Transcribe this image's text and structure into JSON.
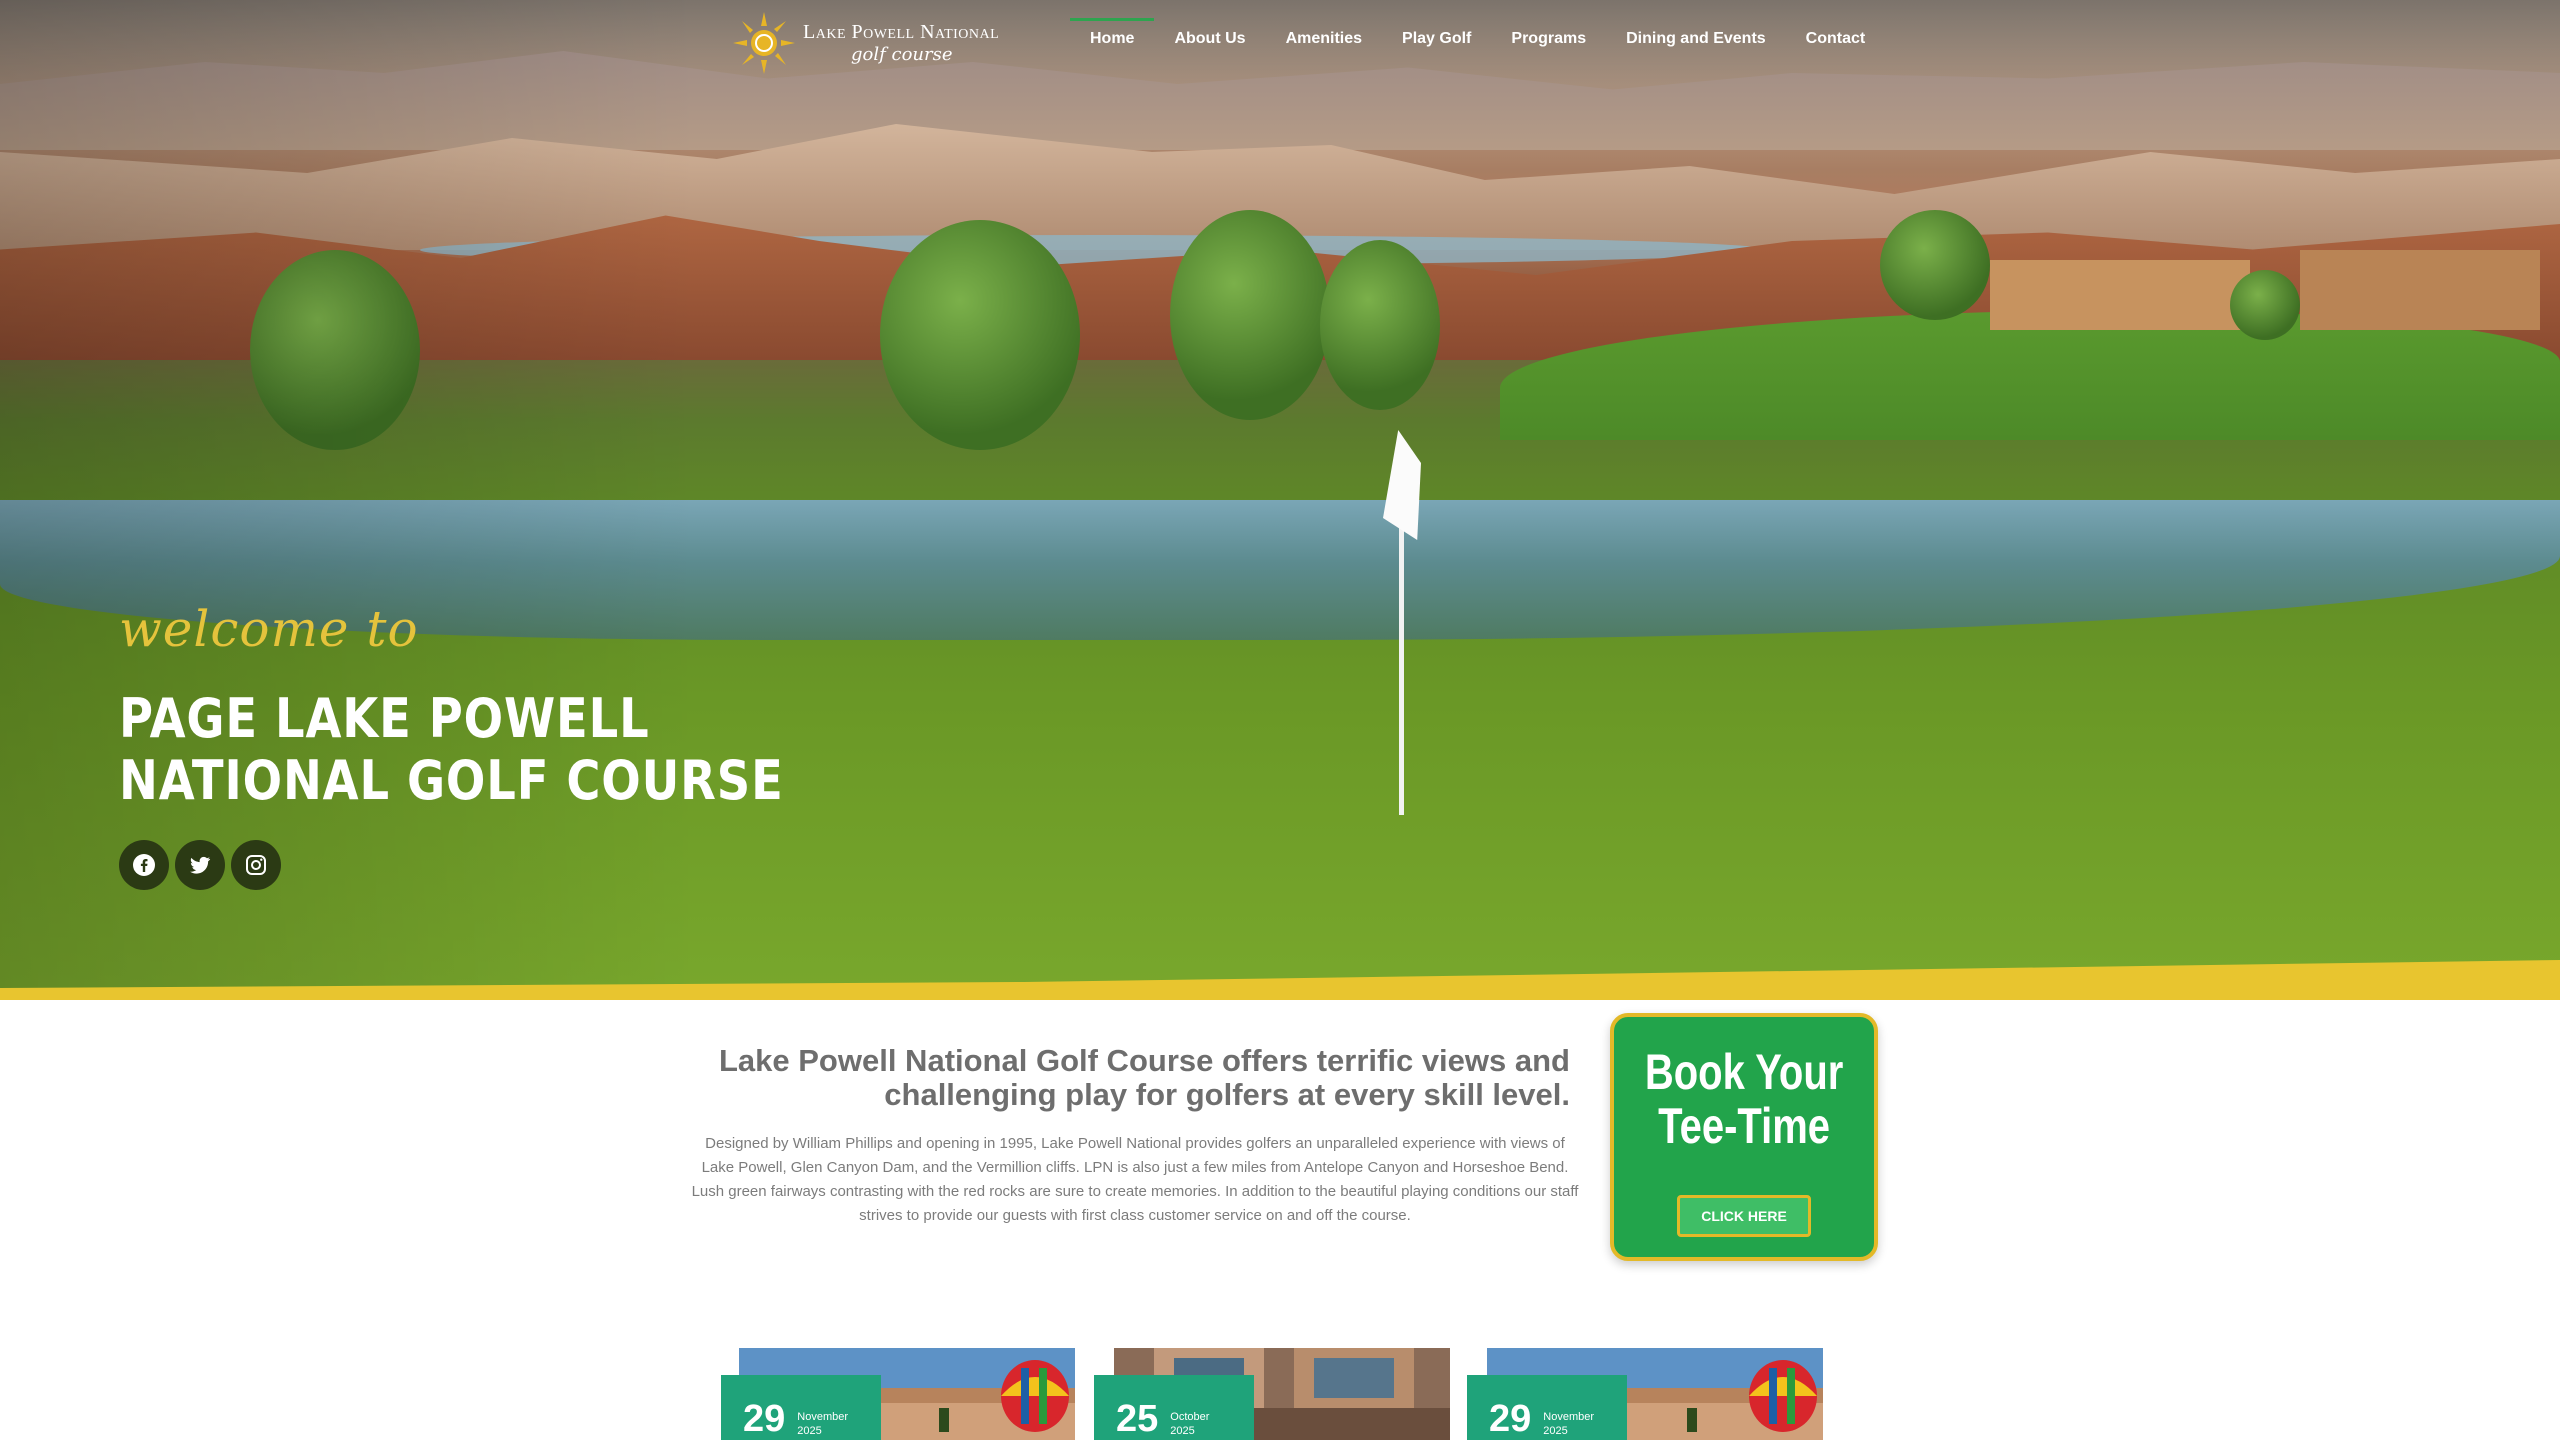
{
  "logo": {
    "title": "Lake Powell National",
    "subtitle": "golf course"
  },
  "nav": {
    "items": [
      {
        "label": "Home",
        "active": true
      },
      {
        "label": "About Us"
      },
      {
        "label": "Amenities"
      },
      {
        "label": "Play Golf"
      },
      {
        "label": "Programs"
      },
      {
        "label": "Dining and Events"
      },
      {
        "label": "Contact"
      }
    ]
  },
  "hero": {
    "welcome": "welcome to",
    "title_line1": "PAGE LAKE POWELL",
    "title_line2": "NATIONAL GOLF COURSE",
    "social": [
      "facebook-icon",
      "twitter-icon",
      "instagram-icon"
    ]
  },
  "intro": {
    "heading": "Lake Powell National Golf Course offers terrific views and challenging play for golfers at every skill level.",
    "body": "Designed by William Phillips and opening in 1995, Lake Powell National provides golfers an unparalleled experience with views of Lake Powell, Glen Canyon Dam, and the Vermillion cliffs. LPN is also just a few miles from Antelope Canyon and Horseshoe Bend. Lush green fairways contrasting with the red rocks are sure to create memories. In addition to the beautiful playing conditions our staff strives to provide our guests with first class customer service on and off the course."
  },
  "booking": {
    "title_line1": "Book Your",
    "title_line2": "Tee-Time",
    "button": "CLICK HERE"
  },
  "events": [
    {
      "day": "29",
      "month": "November",
      "year": "2025"
    },
    {
      "day": "25",
      "month": "October",
      "year": "2025"
    },
    {
      "day": "29",
      "month": "November",
      "year": "2025"
    }
  ],
  "colors": {
    "accent_green": "#22a44b",
    "accent_yellow": "#e3b928",
    "date_teal": "#1fa37a"
  }
}
